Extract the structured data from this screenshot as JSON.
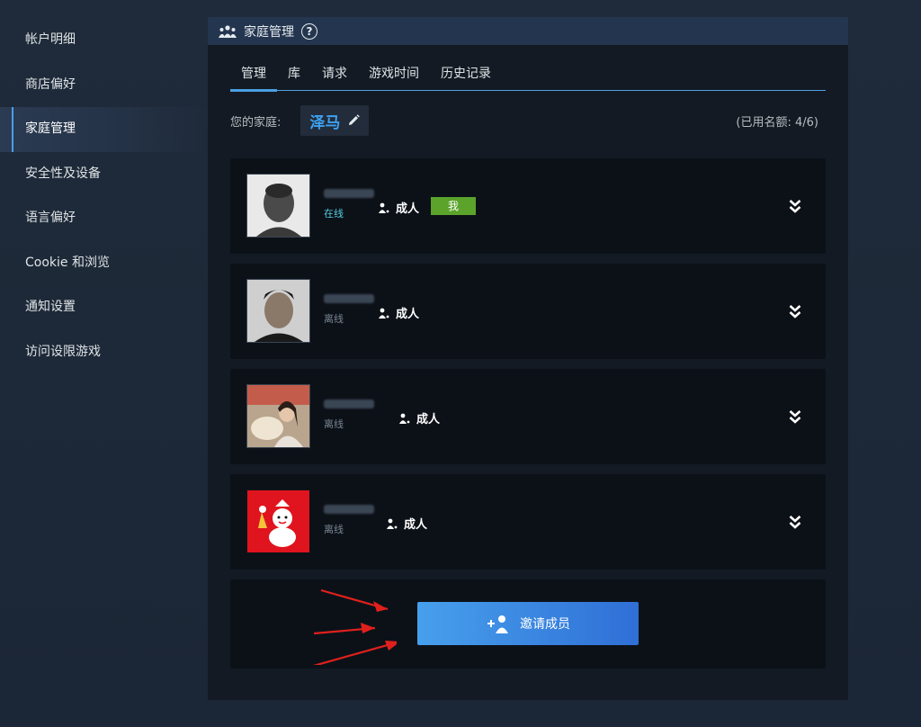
{
  "sidebar": {
    "items": [
      {
        "label": "帐户明细"
      },
      {
        "label": "商店偏好"
      },
      {
        "label": "家庭管理"
      },
      {
        "label": "安全性及设备"
      },
      {
        "label": "语言偏好"
      },
      {
        "label": "Cookie 和浏览"
      },
      {
        "label": "通知设置"
      },
      {
        "label": "访问设限游戏"
      }
    ],
    "active_index": 2
  },
  "panel": {
    "title": "家庭管理",
    "help_symbol": "?",
    "tabs": [
      {
        "label": "管理"
      },
      {
        "label": "库"
      },
      {
        "label": "请求"
      },
      {
        "label": "游戏时间"
      },
      {
        "label": "历史记录"
      }
    ],
    "active_tab": 0,
    "family_label": "您的家庭:",
    "family_name": "泽马",
    "quota": "(已用名额: 4/6)"
  },
  "members": [
    {
      "status": "在线",
      "role": "成人",
      "badge": "我"
    },
    {
      "status": "离线",
      "role": "成人"
    },
    {
      "status": "离线",
      "role": "成人"
    },
    {
      "status": "离线",
      "role": "成人"
    }
  ],
  "invite": {
    "label": "邀请成员"
  },
  "colors": {
    "accent": "#4b9fe3",
    "family_name": "#3da1f1",
    "me_badge": "#5ba32b",
    "invite_button": "#2f6fd6"
  }
}
